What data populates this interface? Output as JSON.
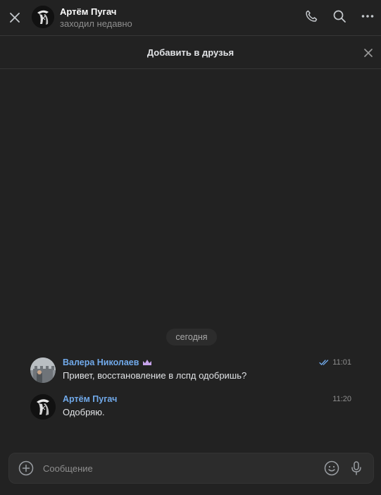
{
  "header": {
    "close_icon": "close-icon",
    "title": "Артём Пугач",
    "subtitle": "заходил недавно",
    "actions": [
      "phone-icon",
      "search-icon",
      "more-icon"
    ]
  },
  "friend_bar": {
    "label": "Добавить в друзья",
    "dismiss_icon": "close-icon"
  },
  "chat": {
    "date_label": "сегодня",
    "messages": [
      {
        "author": "Валера Николаев",
        "author_badge": "crown-icon",
        "text": "Привет, восстановление в лспд одобришь?",
        "time": "11:01",
        "status": "read-double-check"
      },
      {
        "author": "Артём Пугач",
        "text": "Одобряю.",
        "time": "11:20"
      }
    ]
  },
  "composer": {
    "placeholder": "Сообщение",
    "value": "",
    "icons": [
      "plus-circle-icon",
      "smile-icon",
      "microphone-icon"
    ]
  },
  "colors": {
    "background": "#222222",
    "accent_link": "#71aaeb",
    "text_primary": "#e1e3e6",
    "text_secondary": "#8e8e8e",
    "badge": "#c6a3ea"
  }
}
